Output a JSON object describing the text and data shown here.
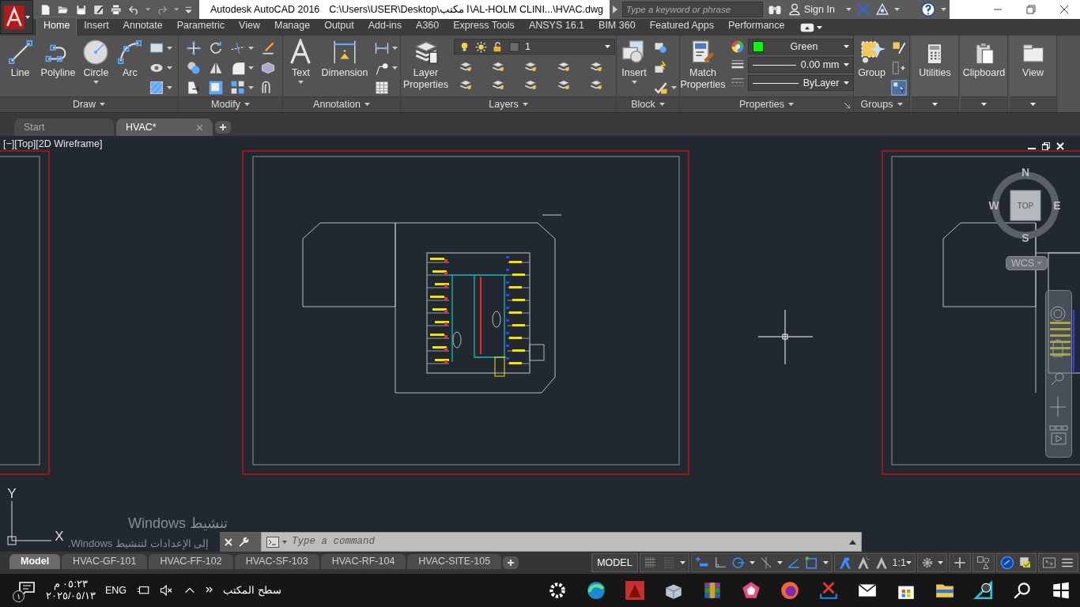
{
  "title_bar": {
    "app_name": "Autodesk AutoCAD 2016",
    "file_path": "C:\\Users\\USER\\Desktop\\ا مكتب\\AL-HOLM CLINI...\\HVAC.dwg",
    "search": {
      "placeholder": "Type a keyword or phrase"
    },
    "sign_in": "Sign In"
  },
  "ribbon_tabs": [
    {
      "label": "Home",
      "selected": true
    },
    {
      "label": "Insert",
      "selected": false
    },
    {
      "label": "Annotate",
      "selected": false
    },
    {
      "label": "Parametric",
      "selected": false
    },
    {
      "label": "View",
      "selected": false
    },
    {
      "label": "Manage",
      "selected": false
    },
    {
      "label": "Output",
      "selected": false
    },
    {
      "label": "Add-ins",
      "selected": false
    },
    {
      "label": "A360",
      "selected": false
    },
    {
      "label": "Express Tools",
      "selected": false
    },
    {
      "label": "ANSYS 16.1",
      "selected": false
    },
    {
      "label": "BIM 360",
      "selected": false
    },
    {
      "label": "Featured Apps",
      "selected": false
    },
    {
      "label": "Performance",
      "selected": false
    }
  ],
  "ribbon_panels": [
    {
      "kind": "draw",
      "title": "Draw",
      "tools": [
        "Line",
        "Polyline",
        "Circle",
        "Arc"
      ]
    },
    {
      "kind": "modify",
      "title": "Modify"
    },
    {
      "kind": "annotation",
      "title": "Annotation",
      "tools": [
        "Text",
        "Dimension"
      ]
    },
    {
      "kind": "layers",
      "title": "Layers",
      "tools": [
        "Layer Properties"
      ],
      "current_layer": "1"
    },
    {
      "kind": "block",
      "title": "Block",
      "tools": [
        "Insert"
      ]
    },
    {
      "kind": "properties",
      "title": "Properties",
      "tools": [
        "Match Properties"
      ],
      "object_color": "Green",
      "lineweight": "0.00 mm",
      "linetype": "ByLayer"
    },
    {
      "kind": "groups",
      "title": "Groups",
      "tools": [
        "Group"
      ]
    },
    {
      "kind": "collapsed",
      "title": "Utilities"
    },
    {
      "kind": "collapsed",
      "title": "Clipboard"
    },
    {
      "kind": "collapsed",
      "title": "View"
    }
  ],
  "document_tabs": [
    {
      "label": "Start",
      "selected": false
    },
    {
      "label": "HVAC*",
      "selected": true
    }
  ],
  "viewport": {
    "label": "[−][Top][2D Wireframe]",
    "viewcube": {
      "top": "TOP",
      "north": "N",
      "south": "S",
      "east": "E",
      "west": "W",
      "coordinate_system": "WCS"
    },
    "ucs": {
      "y": "Y",
      "x": "X"
    }
  },
  "activation_notice": {
    "title": "تنشيط Windows",
    "message": "إلى الإعدادات لتنشيط Windows."
  },
  "command_line": {
    "placeholder": "Type a command"
  },
  "layout_tabs": [
    {
      "label": "Model",
      "selected": true
    },
    {
      "label": "HVAC-GF-101",
      "selected": false
    },
    {
      "label": "HVAC-FF-102",
      "selected": false
    },
    {
      "label": "HVAC-SF-103",
      "selected": false
    },
    {
      "label": "HVAC-RF-104",
      "selected": false
    },
    {
      "label": "HVAC-SITE-105",
      "selected": false
    }
  ],
  "status_bar": {
    "model": "MODEL",
    "scale": "1:1"
  },
  "taskbar": {
    "notification_count": "١",
    "time": "٠٥:٢٣ م",
    "date": "٢٠٢٥/٠٥/١٣",
    "language": "ENG",
    "desktop": "سطح المكتب"
  }
}
